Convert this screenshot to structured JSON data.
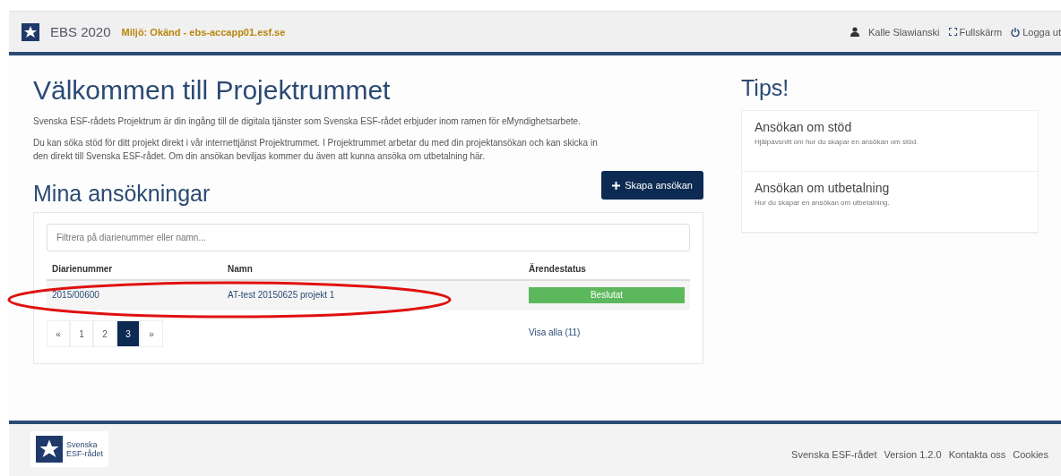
{
  "header": {
    "app_name": "EBS 2020",
    "environment": "Miljö: Okänd - ebs-accapp01.esf.se",
    "user": "Kalle Slawianski",
    "fullscreen": "Fullskärm",
    "logout": "Logga ut"
  },
  "welcome": {
    "title": "Välkommen till Projektrummet",
    "paragraphs": [
      "Svenska ESF-rådets Projektrum är din ingång till de digitala tjänster som Svenska ESF-rådet erbjuder inom ramen för eMyndighetsarbete.",
      "Du kan söka stöd för ditt projekt direkt i vår internettjänst Projektrummet. I Projektrummet arbetar du med din projektansökan och kan skicka in den direkt till Svenska ESF-rådet. Om din ansökan beviljas kommer du även att kunna ansöka om utbetalning här."
    ]
  },
  "applications": {
    "title": "Mina ansökningar",
    "create_button": "Skapa ansökan",
    "filter": {
      "placeholder": "Filtrera på diarienummer eller namn..."
    },
    "columns": [
      "Diarienummer",
      "Namn",
      "Ärendestatus"
    ],
    "rows": [
      {
        "number": "2015/00600",
        "name": "AT-test 20150625 projekt 1",
        "status": "Beslutat",
        "color": "#5cb85c",
        "highlighted": true
      }
    ],
    "pagination": [
      {
        "label": "«",
        "selected": false
      },
      {
        "label": "1",
        "selected": false
      },
      {
        "label": "2",
        "selected": false
      },
      {
        "label": "3",
        "selected": true
      },
      {
        "label": "»",
        "selected": false
      }
    ],
    "show_all": "Visa alla (11)"
  },
  "tips": {
    "title": "Tips!",
    "items": [
      {
        "title": "Ansökan om stöd",
        "text": "Hjälpavsnitt om hur du skapar en ansökan om stöd."
      },
      {
        "title": "Ansökan om utbetalning",
        "text": "Hur du skapar en ansökan om utbetalning."
      }
    ]
  },
  "footer": {
    "logo_text": [
      "Svenska",
      "ESF-rådet"
    ],
    "links": [
      "Svenska ESF-rådet",
      "Version 1.2.0",
      "Kontakta oss",
      "Cookies"
    ]
  }
}
